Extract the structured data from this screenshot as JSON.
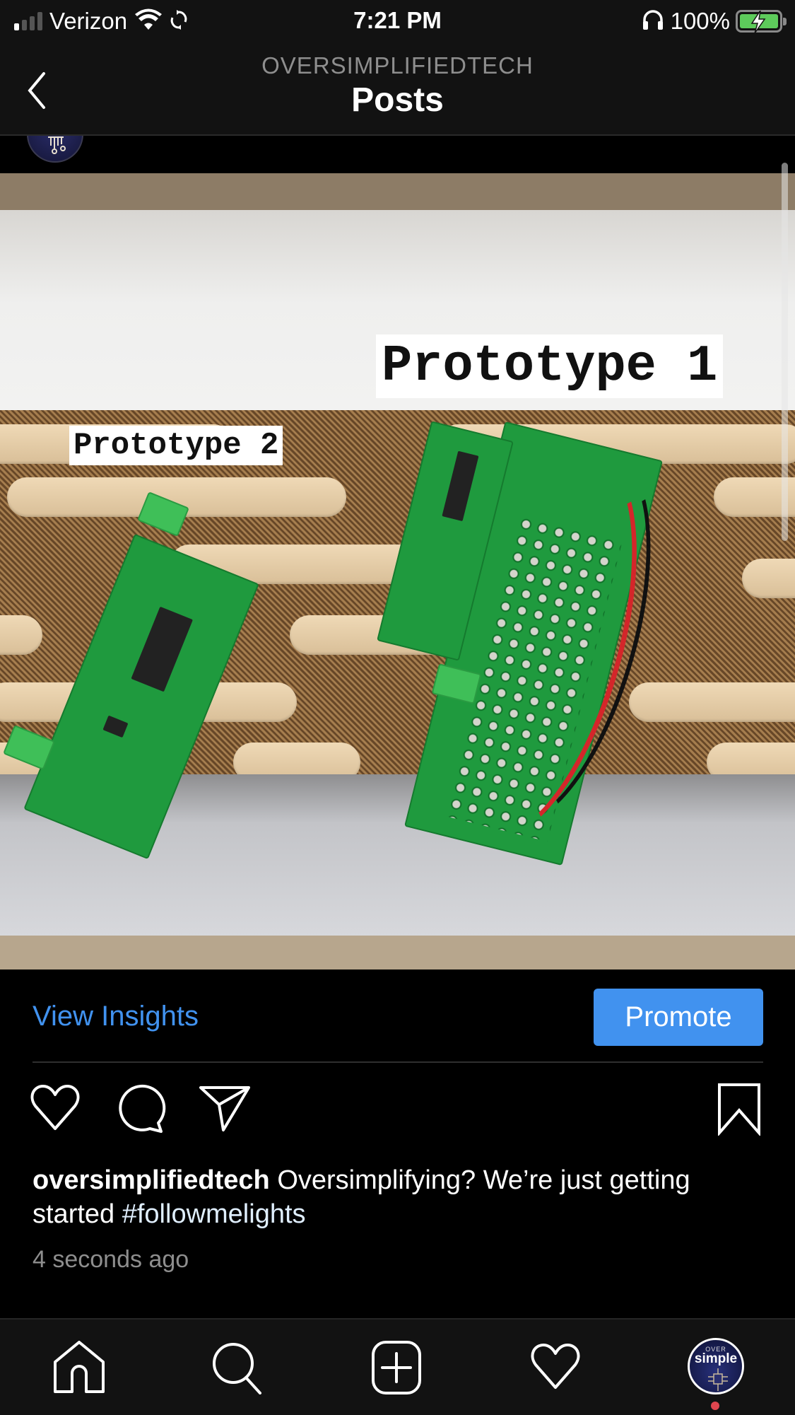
{
  "status_bar": {
    "carrier": "Verizon",
    "time": "7:21 PM",
    "battery_percent": "100%",
    "signal_bars_on": 1,
    "signal_bars_total": 4,
    "icons": [
      "signal-icon",
      "wifi-icon",
      "sync-icon",
      "headphones-icon",
      "battery-charging-icon"
    ],
    "battery_color": "#5dcb5b"
  },
  "nav": {
    "subtitle": "OVERSIMPLIFIEDTECH",
    "title": "Posts",
    "back_icon": "chevron-left-icon"
  },
  "post": {
    "image": {
      "description": "Two green circuit board prototypes on a laser-cut wooden panel",
      "labels": [
        "Prototype 1",
        "Prototype 2"
      ]
    },
    "insights_label": "View Insights",
    "promote_label": "Promote",
    "actions": [
      "heart-icon",
      "comment-icon",
      "share-icon",
      "bookmark-icon"
    ],
    "caption": {
      "username": "oversimplifiedtech",
      "text": " Oversimplifying? We’re just getting started ",
      "hashtag": "#followmelights"
    },
    "time_ago": "4 seconds ago"
  },
  "tab_bar": {
    "tabs": [
      "home",
      "search",
      "new-post",
      "activity",
      "profile"
    ],
    "profile_avatar_top": "OVER",
    "profile_avatar_main": "simple",
    "notification_dot_color": "#e0464f"
  },
  "colors": {
    "accent_blue": "#4192ef",
    "header_bg": "#121212",
    "page_bg": "#000000",
    "muted_text": "#8e8e8e"
  }
}
